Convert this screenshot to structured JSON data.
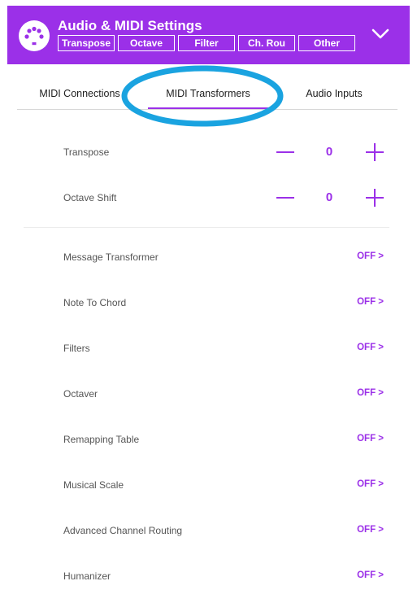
{
  "header": {
    "title": "Audio & MIDI Settings",
    "logo_icon": "midi-din-icon",
    "collapse_icon": "chevron-down-icon",
    "quick_tabs": [
      {
        "label": "Transpose"
      },
      {
        "label": "Octave"
      },
      {
        "label": "Filter"
      },
      {
        "label": "Ch. Rou"
      },
      {
        "label": "Other"
      }
    ]
  },
  "tabs": [
    {
      "label": "MIDI Connections",
      "active": false
    },
    {
      "label": "MIDI Transformers",
      "active": true
    },
    {
      "label": "Audio Inputs",
      "active": false
    }
  ],
  "steppers": [
    {
      "label": "Transpose",
      "value": "0",
      "minus_icon": "minus-icon",
      "plus_icon": "plus-icon"
    },
    {
      "label": "Octave Shift",
      "value": "0",
      "minus_icon": "minus-icon",
      "plus_icon": "plus-icon"
    }
  ],
  "transformers": [
    {
      "label": "Message Transformer",
      "status": "OFF >"
    },
    {
      "label": "Note To Chord",
      "status": "OFF >"
    },
    {
      "label": "Filters",
      "status": "OFF >"
    },
    {
      "label": "Octaver",
      "status": "OFF >"
    },
    {
      "label": "Remapping Table",
      "status": "OFF >"
    },
    {
      "label": "Musical Scale",
      "status": "OFF >"
    },
    {
      "label": "Advanced Channel Routing",
      "status": "OFF >"
    },
    {
      "label": "Humanizer",
      "status": "OFF >"
    }
  ],
  "colors": {
    "accent": "#9b30e8",
    "highlight_ring": "#1aa3e0",
    "text_primary": "#1e1e1e",
    "text_secondary": "#555555"
  }
}
